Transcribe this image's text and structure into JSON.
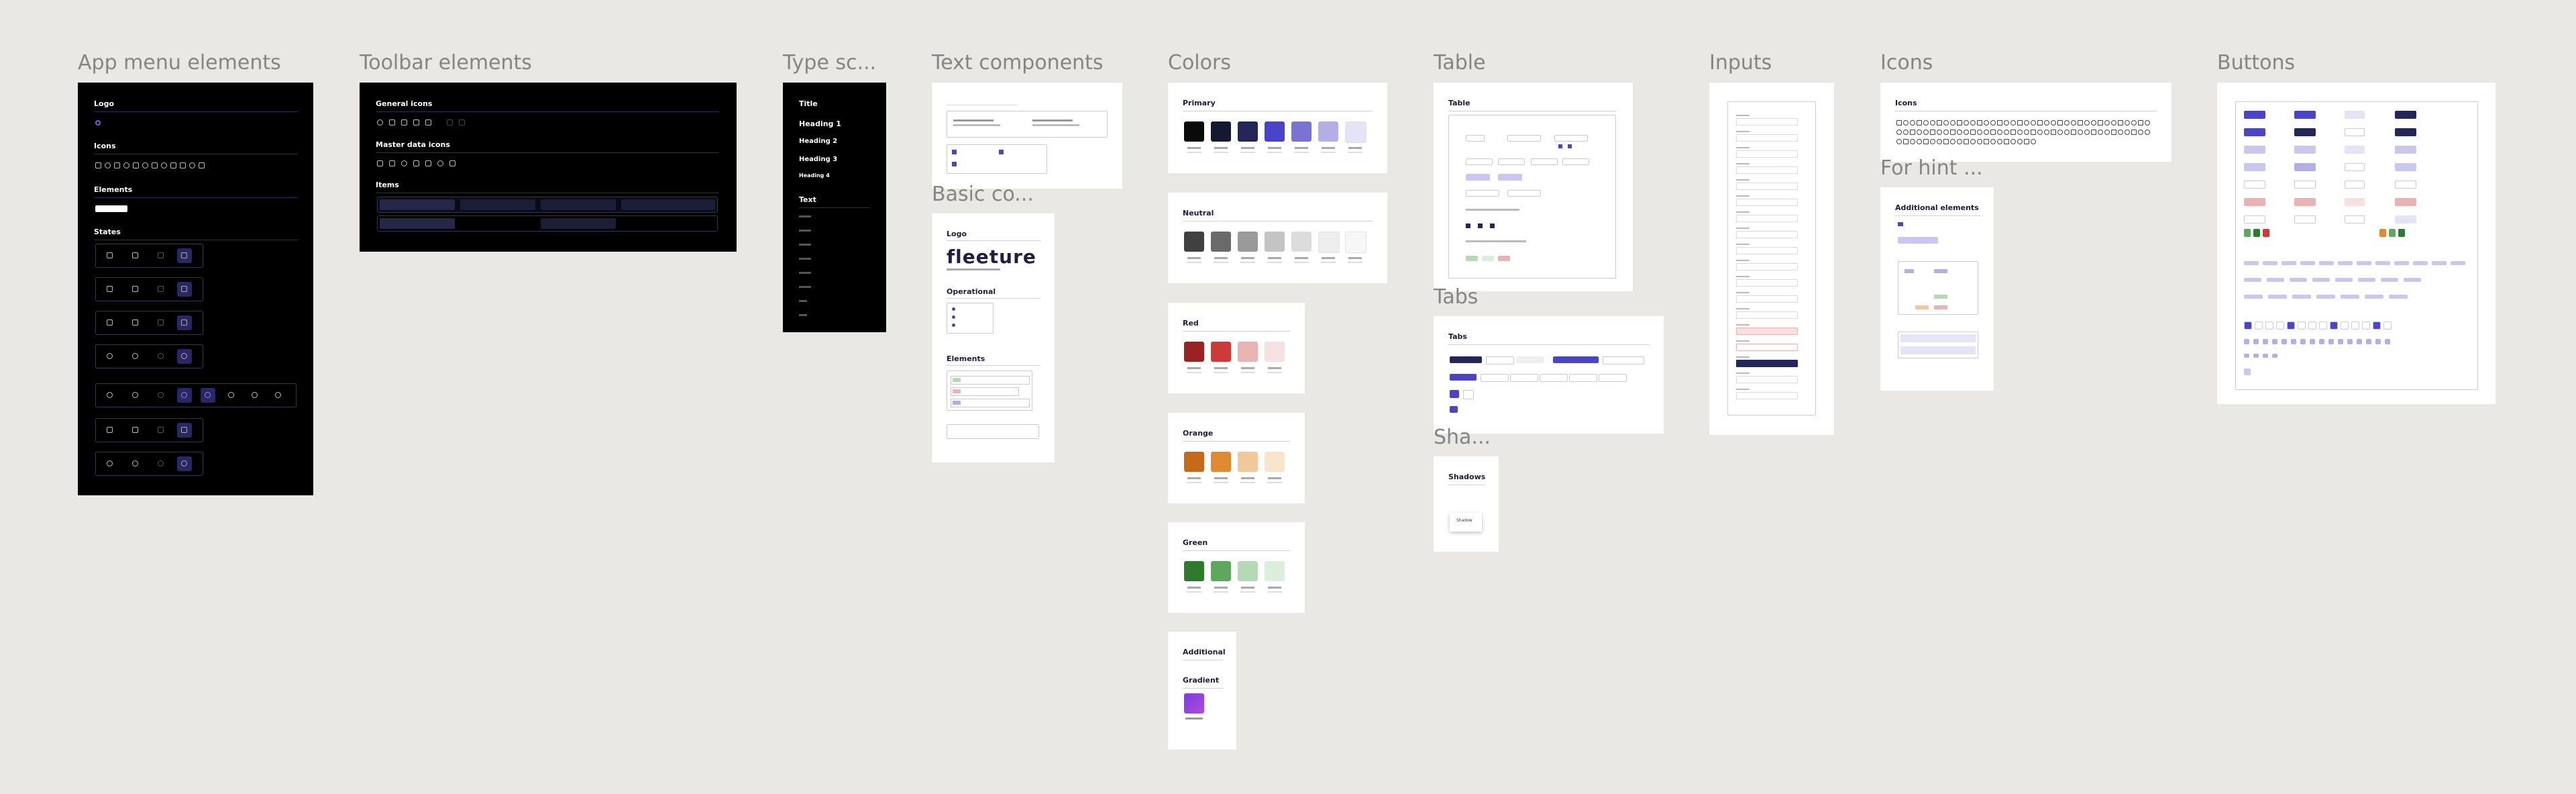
{
  "frames": {
    "app_menu": {
      "title": "App menu elements",
      "logo": "Logo",
      "icons": "Icons",
      "elements": "Elements",
      "states": "States"
    },
    "toolbar": {
      "title": "Toolbar elements",
      "general_icons": "General icons",
      "master_data_icons": "Master data icons",
      "items": "Items"
    },
    "type_scale": {
      "title": "Type sc...",
      "items": [
        "Title",
        "Heading 1",
        "Heading 2",
        "Heading 3",
        "Heading 4",
        "Text"
      ]
    },
    "text_components": {
      "title": "Text components"
    },
    "basic_components": {
      "title": "Basic co...",
      "logo": "Logo",
      "brand": "fleeture",
      "operational": "Operational",
      "elements": "Elements"
    },
    "colors": {
      "title": "Colors",
      "primary": "Primary",
      "neutral": "Neutral",
      "red": "Red",
      "orange": "Orange",
      "green": "Green",
      "additional": "Additional",
      "gradient": "Gradient"
    },
    "table": {
      "title": "Table",
      "inner": "Table"
    },
    "tabs": {
      "title": "Tabs",
      "inner": "Tabs"
    },
    "shadows": {
      "title": "Sha...",
      "inner": "Shadows",
      "sample": "Shadow"
    },
    "inputs": {
      "title": "Inputs"
    },
    "icons": {
      "title": "Icons",
      "inner": "Icons"
    },
    "hint": {
      "title": "For hint ...",
      "inner": "Additional elements"
    },
    "buttons": {
      "title": "Buttons"
    }
  },
  "colors": {
    "primary": [
      "#0a0a0a",
      "#141830",
      "#24265a",
      "#4a45c8",
      "#7a73d4",
      "#b3afe6",
      "#e5e4f6"
    ],
    "neutral": [
      "#404040",
      "#6a6a6a",
      "#9a9a9a",
      "#c4c4c4",
      "#dcdcdc",
      "#eeeeee",
      "#f7f7f7"
    ],
    "red": [
      "#9b2222",
      "#cd3a3a",
      "#e9b3b3",
      "#f6e1e1"
    ],
    "orange": [
      "#c46a1a",
      "#e08a32",
      "#f0c89a",
      "#f9e4cc"
    ],
    "green": [
      "#2e7a2e",
      "#5ea85e",
      "#b4d9b4",
      "#dcefdc"
    ],
    "gradient": [
      "#7a3ae6",
      "#b14ad8"
    ]
  }
}
